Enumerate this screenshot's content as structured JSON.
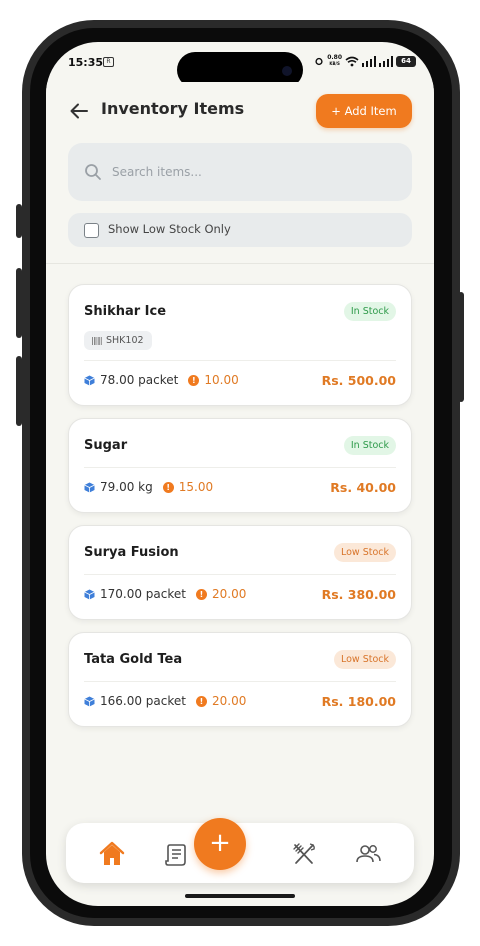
{
  "status_bar": {
    "time": "15:35",
    "sim_label": "R",
    "net_speed": "0.80",
    "net_unit": "KB/S",
    "battery": "64"
  },
  "header": {
    "title": "Inventory Items",
    "add_label": "+ Add Item"
  },
  "search": {
    "placeholder": "Search items..."
  },
  "filter": {
    "low_stock_label": "Show Low Stock Only",
    "checked": false
  },
  "colors": {
    "accent": "#f07a1f",
    "in_stock": "#2e9a4a",
    "low_stock": "#d8742a"
  },
  "items": [
    {
      "name": "Shikhar Ice",
      "status": "In Stock",
      "status_type": "instock",
      "sku": "SHK102",
      "quantity": "78.00 packet",
      "reorder_level": "10.00",
      "price": "Rs. 500.00"
    },
    {
      "name": "Sugar",
      "status": "In Stock",
      "status_type": "instock",
      "quantity": "79.00 kg",
      "reorder_level": "15.00",
      "price": "Rs. 40.00"
    },
    {
      "name": "Surya Fusion",
      "status": "Low Stock",
      "status_type": "lowstock",
      "quantity": "170.00 packet",
      "reorder_level": "20.00",
      "price": "Rs. 380.00"
    },
    {
      "name": "Tata Gold Tea",
      "status": "Low Stock",
      "status_type": "lowstock",
      "quantity": "166.00 packet",
      "reorder_level": "20.00",
      "price": "Rs. 180.00"
    }
  ],
  "bottom_nav": {
    "items": [
      "home-icon",
      "receipt-icon",
      "add-icon",
      "dining-icon",
      "users-icon"
    ],
    "fab_symbol": "+"
  }
}
